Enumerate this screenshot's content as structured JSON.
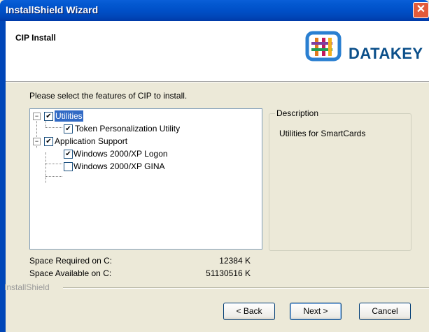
{
  "window": {
    "title": "InstallShield Wizard",
    "close_glyph": "✕"
  },
  "header": {
    "title": "CIP Install",
    "logo_text": "DATAKEY"
  },
  "instruction": "Please select the features of CIP to install.",
  "tree": {
    "items": [
      {
        "label": "Utilities",
        "checked": true,
        "expander": "−"
      },
      {
        "label": "Token Personalization Utility",
        "checked": true
      },
      {
        "label": "Application Support",
        "checked": true,
        "expander": "−"
      },
      {
        "label": "Windows 2000/XP Logon",
        "checked": true
      },
      {
        "label": "Windows 2000/XP GINA",
        "checked": false
      }
    ]
  },
  "description": {
    "legend": "Description",
    "text": "Utilities for SmartCards"
  },
  "space": {
    "required_label": "Space Required on  C:",
    "required_value": "12384 K",
    "available_label": "Space Available on  C:",
    "available_value": "51130516 K"
  },
  "footer_brand": "InstallShield",
  "buttons": {
    "back": "< Back",
    "next": "Next >",
    "cancel": "Cancel"
  }
}
